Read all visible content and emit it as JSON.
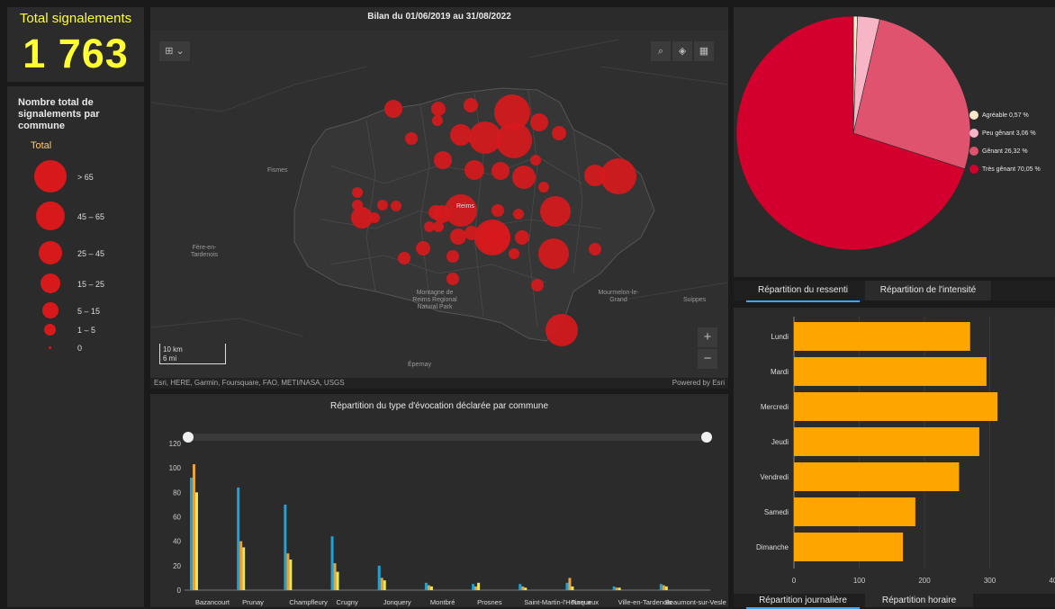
{
  "kpi": {
    "title": "Total signalements",
    "value": "1 763"
  },
  "legend": {
    "title": "Nombre total de signalements par commune",
    "subtitle": "Total",
    "items": [
      ">  65",
      "45 – 65",
      "25 – 45",
      "15 – 25",
      "5 – 15",
      "1 – 5",
      "0"
    ]
  },
  "map": {
    "title": "Bilan du 01/06/2019 au 31/08/2022",
    "attribution": "Esri, HERE, Garmin, Foursquare, FAO, METI/NASA, USGS",
    "powered": "Powered by Esri",
    "scale_km": "10 km",
    "scale_mi": "6 mi",
    "labels": [
      "Fismes",
      "Reims",
      "Fère-en-Tardenois",
      "Montagne de Reims Regional Natural Park",
      "Mourmelon-le-Grand",
      "Suippes",
      "Épernay"
    ],
    "zoom_in": "+",
    "zoom_out": "−",
    "accent": "#d7191c"
  },
  "pie": {
    "chart_data": {
      "type": "pie",
      "labels": [
        "Agréable",
        "Peu gênant",
        "Gênant",
        "Très gênant"
      ],
      "values": [
        0.57,
        3.06,
        26.32,
        70.05
      ],
      "colors": [
        "#fde7c9",
        "#f7b6c5",
        "#e0536f",
        "#d3002d"
      ],
      "legend_position": "right"
    },
    "legend": [
      "Agréable  0,57 %",
      "Peu gênant  3,06 %",
      "Gênant  26,32 %",
      "Très gênant  70,05 %"
    ]
  },
  "tabs_top": [
    "Répartition du ressenti",
    "Répartition de l'intensité"
  ],
  "weekday_chart": {
    "chart_data": {
      "type": "bar",
      "orientation": "horizontal",
      "categories": [
        "Lundi",
        "Mardi",
        "Mercredi",
        "Jeudi",
        "Vendredi",
        "Samedi",
        "Dimanche"
      ],
      "values": [
        270,
        295,
        312,
        284,
        253,
        186,
        167
      ],
      "xlim": [
        0,
        400
      ],
      "xticks": [
        "0",
        "100",
        "200",
        "300",
        "400"
      ],
      "color": "#ffa500"
    }
  },
  "tabs_bottom": [
    "Répartition journalière",
    "Répartition horaire"
  ],
  "commune_chart": {
    "title": "Répartition du type d'évocation déclarée par commune",
    "chart_data": {
      "type": "bar",
      "ylim": [
        0,
        120
      ],
      "yticks": [
        "0",
        "20",
        "40",
        "60",
        "80",
        "100",
        "120"
      ],
      "categories": [
        "Bazancourt",
        "Prunay",
        "Champfleury",
        "Crugny",
        "Jonquery",
        "Montbré",
        "Prosnes",
        "Saint-Martin-l'Heureux",
        "Tinqueux",
        "Ville-en-Tardenois",
        "Beaumont-sur-Vesle"
      ],
      "series": [
        {
          "color": "#1fa2d6",
          "values": [
            92,
            84,
            70,
            44,
            20,
            6,
            5,
            5,
            6,
            3,
            5
          ]
        },
        {
          "color": "#e8a33a",
          "values": [
            103,
            40,
            30,
            22,
            10,
            4,
            3,
            3,
            10,
            2,
            4
          ]
        },
        {
          "color": "#e8e854",
          "values": [
            80,
            35,
            25,
            15,
            8,
            3,
            6,
            2,
            3,
            2,
            3
          ]
        }
      ]
    }
  }
}
